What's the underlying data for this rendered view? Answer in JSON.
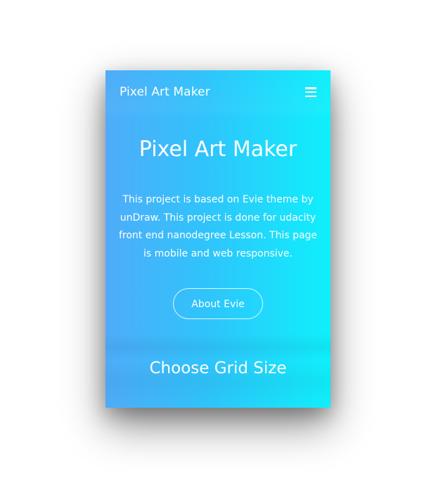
{
  "navbar": {
    "brand": "Pixel Art Maker",
    "menu_icon": "hamburger-icon"
  },
  "hero": {
    "title": "Pixel Art Maker",
    "description": "This project is based on Evie theme by unDraw. This project is done for udacity front end nanodegree Lesson. This page is mobile and web responsive.",
    "button_label": "About Evie"
  },
  "grid_section": {
    "title": "Choose Grid Size"
  },
  "colors": {
    "gradient_start": "#4facf9",
    "gradient_end": "#0ff0fc",
    "text": "#ffffff"
  }
}
